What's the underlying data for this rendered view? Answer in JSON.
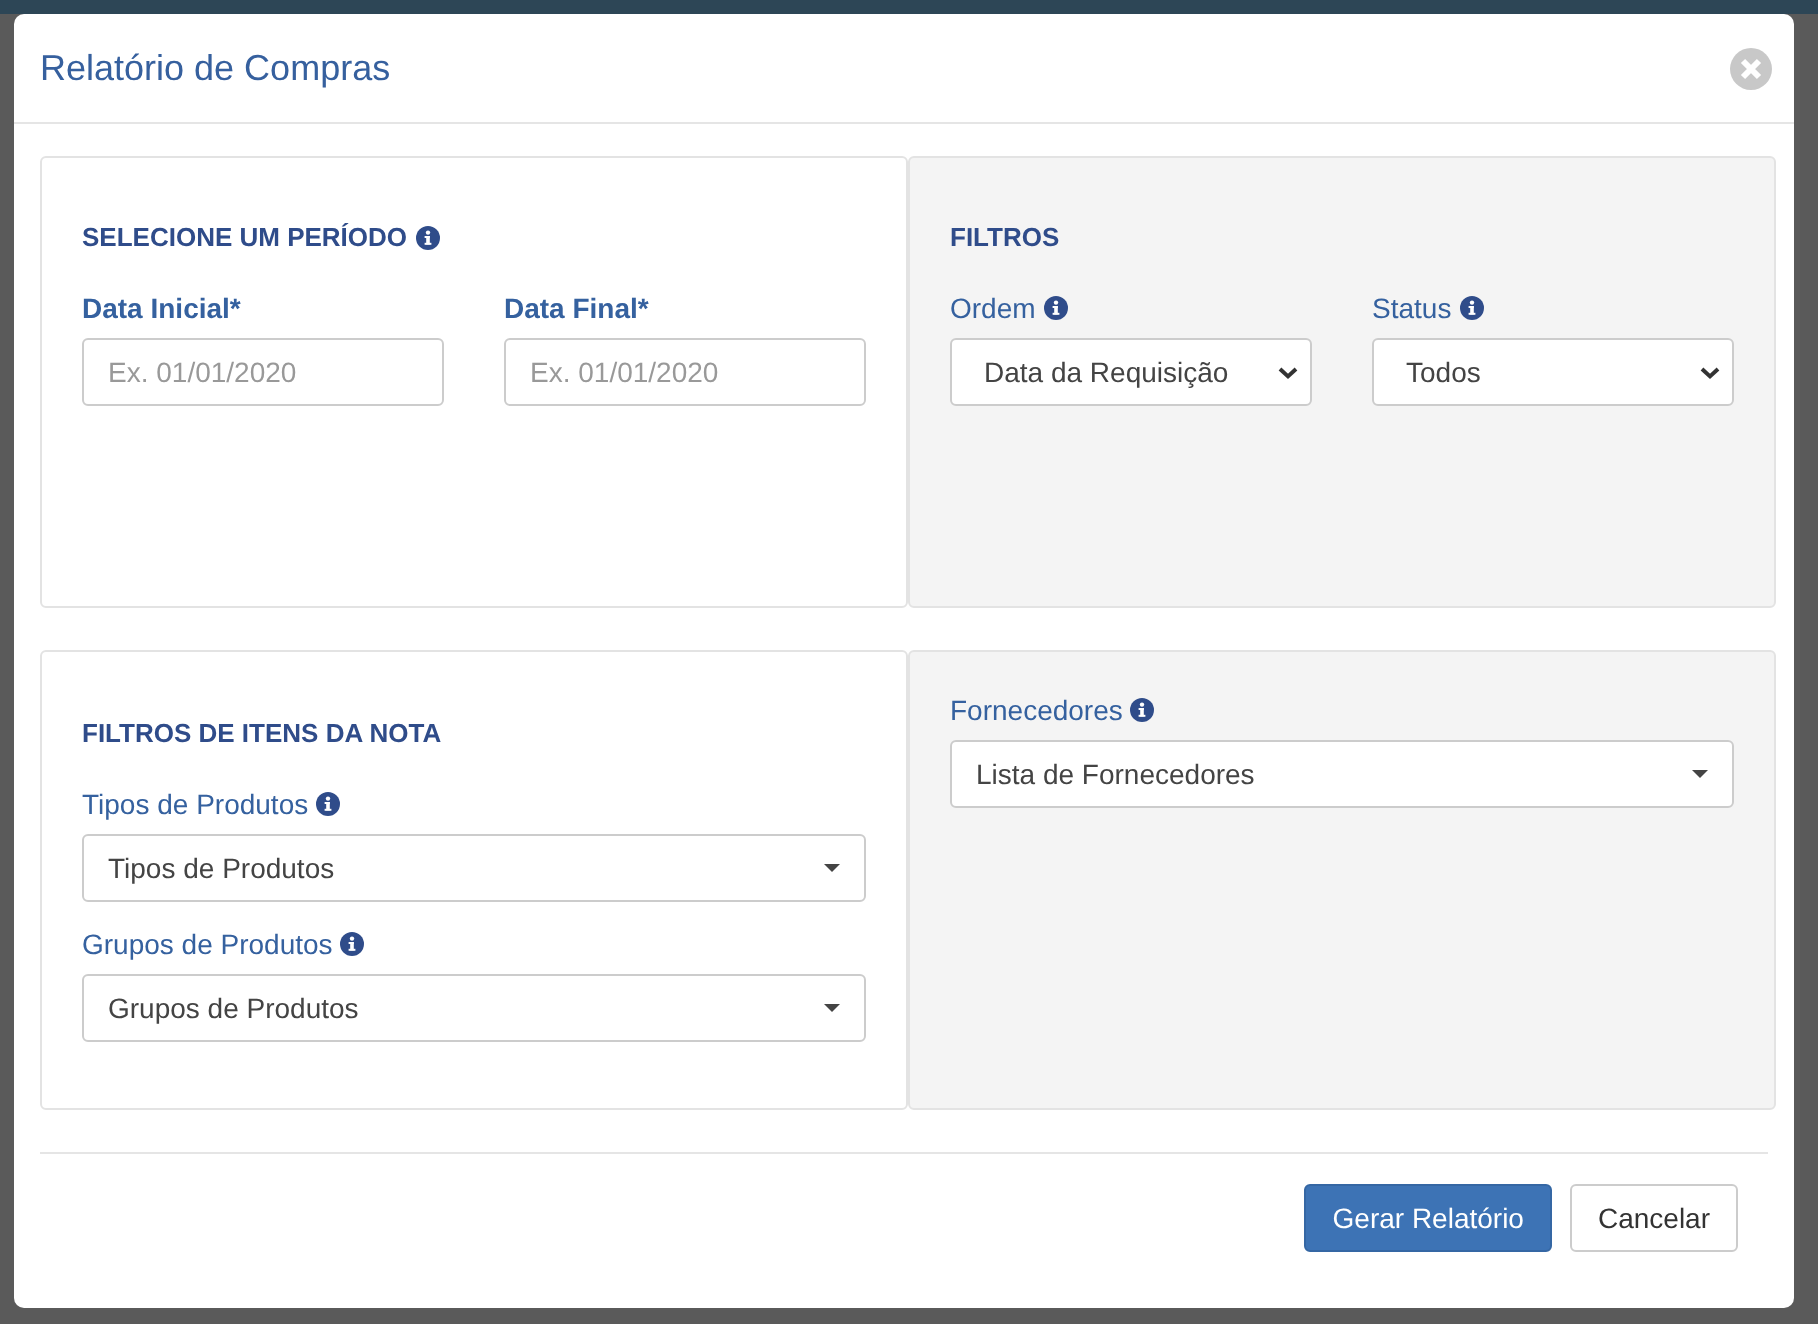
{
  "dialog": {
    "title": "Relatório de Compras"
  },
  "period": {
    "title": "SELECIONE UM PERÍODO",
    "info": true,
    "fields": [
      {
        "label": "Data Inicial*",
        "placeholder": "Ex. 01/01/2020"
      },
      {
        "label": "Data Final*",
        "placeholder": "Ex. 01/01/2020"
      }
    ]
  },
  "filters": {
    "title": "FILTROS",
    "info": false,
    "selects": [
      {
        "label": "Ordem",
        "info": true,
        "value": "Data da Requisição",
        "kind": "native"
      },
      {
        "label": "Status",
        "info": true,
        "value": "Todos",
        "kind": "native"
      }
    ]
  },
  "item_filters": {
    "title": "FILTROS DE ITENS DA NOTA",
    "info": false,
    "selects": [
      {
        "label": "Tipos de Produtos",
        "info": true,
        "value": "Tipos de Produtos",
        "kind": "picker"
      },
      {
        "label": "Grupos de Produtos",
        "info": true,
        "value": "Grupos de Produtos",
        "kind": "picker"
      }
    ]
  },
  "suppliers": {
    "selects": [
      {
        "label": "Fornecedores",
        "info": true,
        "value": "Lista de Fornecedores",
        "kind": "picker"
      }
    ]
  },
  "buttons": [
    {
      "label": "Gerar Relatório",
      "kind": "primary"
    },
    {
      "label": "Cancelar",
      "kind": "default"
    }
  ]
}
